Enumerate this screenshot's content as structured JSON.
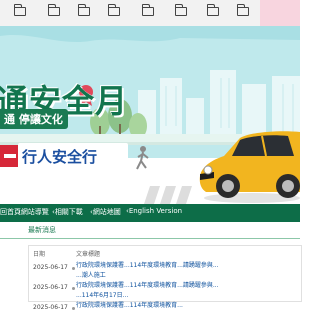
{
  "banner": {
    "title": "通安全月",
    "subtitle": "通 停讓文化",
    "slogan": "行人安全行"
  },
  "navbar": {
    "items": [
      "回首頁",
      "網站導覽",
      "相關下載",
      "網站地圖",
      "English Version"
    ]
  },
  "content": {
    "section_title": "最新消息",
    "table": {
      "headers": [
        "日期",
        "文章標題"
      ],
      "rows": [
        {
          "date": "2025-06-17",
          "title": "行政院環境保護署...114年度環境教育...請踴躍參與...",
          "title_cont": "...潮人施工"
        },
        {
          "date": "2025-06-17",
          "title": "行政院環境保護署...114年度環境教育...請踴躍參與...",
          "title_cont": "...114年6月17日..."
        },
        {
          "date": "2025-06-17",
          "title": "行政院環境保護署...114年度環境教育..."
        }
      ]
    }
  },
  "colors": {
    "brand_green": "#0d6d48",
    "banner_bg": "#bfe9ec",
    "slogan_blue": "#1b4fa0"
  }
}
